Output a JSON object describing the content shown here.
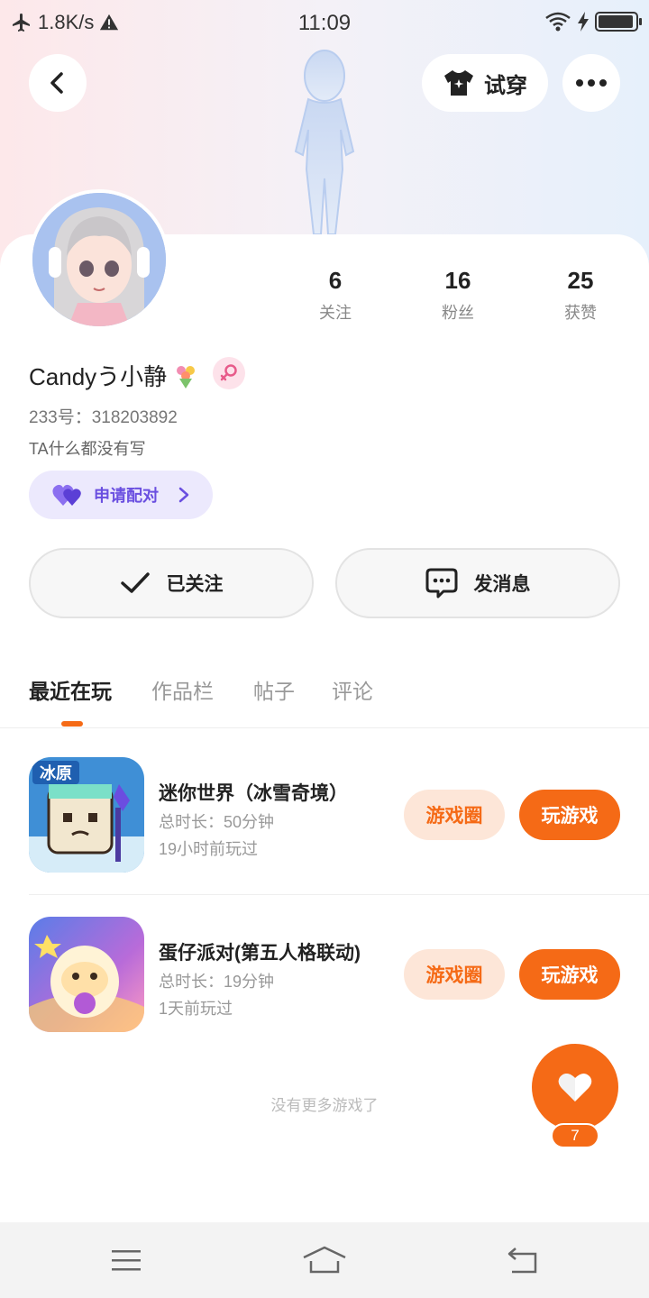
{
  "status_bar": {
    "net_speed": "1.8K/s",
    "time": "11:09",
    "battery_level": 0.95
  },
  "header": {
    "tryon_label": "试穿"
  },
  "profile": {
    "username": "Candyう小静",
    "uid": "233号：318203892",
    "bio": "TA什么都没有写",
    "pair_label": "申请配对",
    "stats": [
      {
        "num": "6",
        "label": "关注"
      },
      {
        "num": "16",
        "label": "粉丝"
      },
      {
        "num": "25",
        "label": "获赞"
      }
    ]
  },
  "actions": {
    "follow_label": "已关注",
    "message_label": "发消息"
  },
  "tabs": [
    {
      "label": "最近在玩",
      "active": true
    },
    {
      "label": "作品栏",
      "active": false
    },
    {
      "label": "帖子",
      "active": false
    },
    {
      "label": "评论",
      "active": false
    }
  ],
  "games": [
    {
      "title": "迷你世界（冰雪奇境）",
      "duration": "总时长：50分钟",
      "last_played": "19小时前玩过",
      "icon_text": "冰原",
      "circle_label": "游戏圈",
      "play_label": "玩游戏"
    },
    {
      "title": "蛋仔派对(第五人格联动)",
      "duration": "总时长：19分钟",
      "last_played": "1天前玩过",
      "icon_text": "",
      "circle_label": "游戏圈",
      "play_label": "玩游戏"
    }
  ],
  "footer_note": "没有更多游戏了",
  "like": {
    "count": "7"
  },
  "colors": {
    "accent": "#f56a16",
    "accent_light": "#fde6d8",
    "pair_purple": "#6a4fe0",
    "pair_bg": "#ece9fd"
  },
  "icons": {
    "back": "chevron-left-icon",
    "tryon": "shirt-icon",
    "more": "more-dots-icon",
    "gender": "female-icon",
    "pair": "heart-icon",
    "follow": "checkmark-icon",
    "message": "chat-bubble-icon",
    "like": "heart-icon"
  }
}
